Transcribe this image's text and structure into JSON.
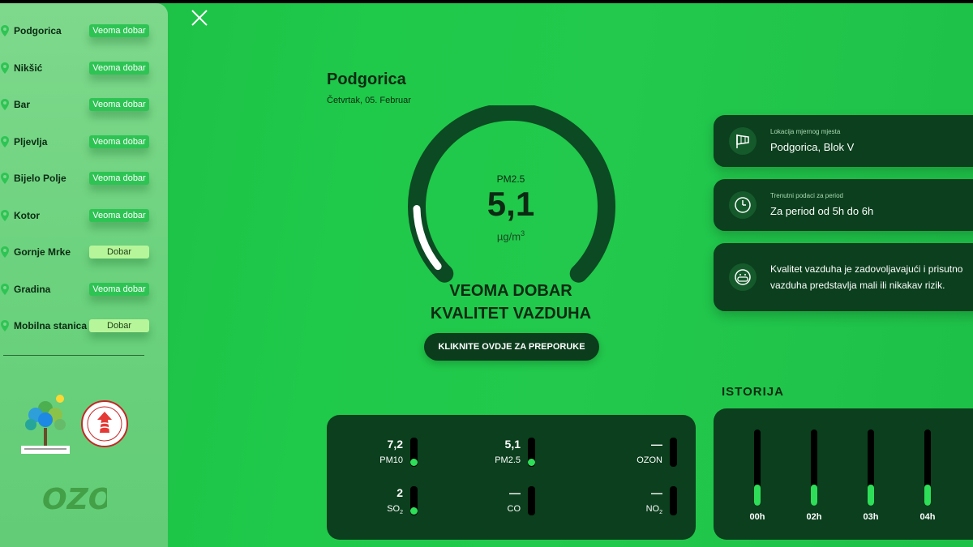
{
  "sidebar": {
    "cities": [
      {
        "name": "Podgorica",
        "status": "Veoma dobar",
        "level": "veoma"
      },
      {
        "name": "Nikšić",
        "status": "Veoma dobar",
        "level": "veoma"
      },
      {
        "name": "Bar",
        "status": "Veoma dobar",
        "level": "veoma"
      },
      {
        "name": "Pljevlja",
        "status": "Veoma dobar",
        "level": "veoma"
      },
      {
        "name": "Bijelo Polje",
        "status": "Veoma dobar",
        "level": "veoma"
      },
      {
        "name": "Kotor",
        "status": "Veoma dobar",
        "level": "veoma"
      },
      {
        "name": "Gornje Mrke",
        "status": "Dobar",
        "level": "dobar"
      },
      {
        "name": "Gradina",
        "status": "Veoma dobar",
        "level": "veoma"
      },
      {
        "name": "Mobilna stanica",
        "status": "Dobar",
        "level": "dobar"
      }
    ],
    "ozon_logo_text": "OZON"
  },
  "header": {
    "city": "Podgorica",
    "date": "Četvrtak, 05. Februar"
  },
  "gauge": {
    "label": "PM2.5",
    "value": "5,1",
    "unit": "µg/m",
    "unit_sup": "3",
    "quality_line1": "VEOMA DOBAR",
    "quality_line2": "KVALITET VAZDUHA",
    "button_label": "KLIKNITE OVDJE ZA PREPORUKE",
    "level_fraction": 0.14
  },
  "info_cards": {
    "location_small": "Lokacija mjernog mjesta",
    "location_main": "Podgorica, Blok V",
    "period_small": "Trenutni podaci za period",
    "period_main": "Za period od 5h do 6h",
    "desc_line1": "Kvalitet vazduha je zadovoljavajući i prisutno",
    "desc_line2": "vazduha predstavlja mali ili nikakav rizik."
  },
  "pollutants": [
    {
      "value": "7,2",
      "label": "PM10",
      "sub": "",
      "has_value": true
    },
    {
      "value": "5,1",
      "label": "PM2.5",
      "sub": "",
      "has_value": true
    },
    {
      "value": "—",
      "label": "OZON",
      "sub": "",
      "has_value": false
    },
    {
      "value": "2",
      "label": "SO",
      "sub": "2",
      "has_value": true
    },
    {
      "value": "—",
      "label": "CO",
      "sub": "",
      "has_value": false
    },
    {
      "value": "—",
      "label": "NO",
      "sub": "2",
      "has_value": false
    }
  ],
  "history": {
    "title": "ISTORIJA",
    "hours": [
      {
        "label": "00h",
        "level": 0.28
      },
      {
        "label": "02h",
        "level": 0.28
      },
      {
        "label": "03h",
        "level": 0.28
      },
      {
        "label": "04h",
        "level": 0.28
      }
    ]
  },
  "colors": {
    "accent": "#2ede58",
    "panel": "#0b3f1d",
    "veoma_dobar": "#2ec454",
    "dobar": "#b7f59a"
  }
}
